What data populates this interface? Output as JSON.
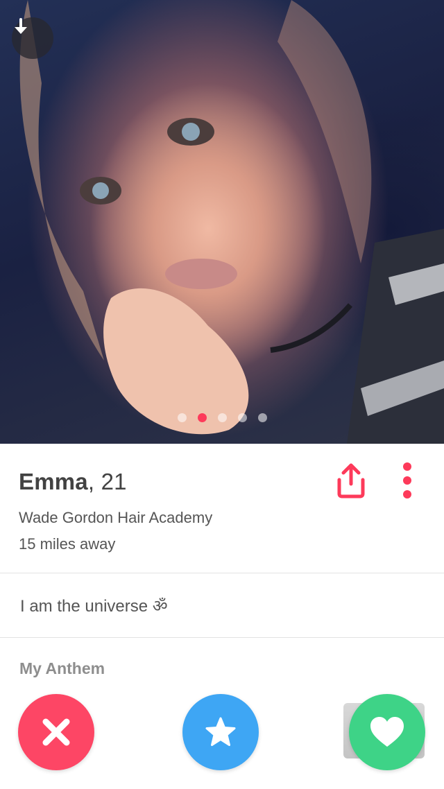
{
  "profile": {
    "name": "Emma",
    "age_suffix": ", 21",
    "school": "Wade Gordon Hair Academy",
    "distance": "15 miles away",
    "bio": "I am the universe ॐ",
    "anthem_label": "My Anthem",
    "photo_count": 5,
    "active_photo_index": 1
  },
  "icons": {
    "download": "download-arrow-icon",
    "share": "share-icon",
    "more": "more-vertical-icon",
    "nope": "close-x-icon",
    "superlike": "star-icon",
    "like": "heart-icon"
  },
  "colors": {
    "brand_accent": "#fd3a5a",
    "nope": "#fd4665",
    "superlike": "#3ea6f4",
    "like": "#3ed387",
    "text_primary": "#424242",
    "text_secondary": "#555555",
    "label_gray": "#8e8e8e"
  }
}
